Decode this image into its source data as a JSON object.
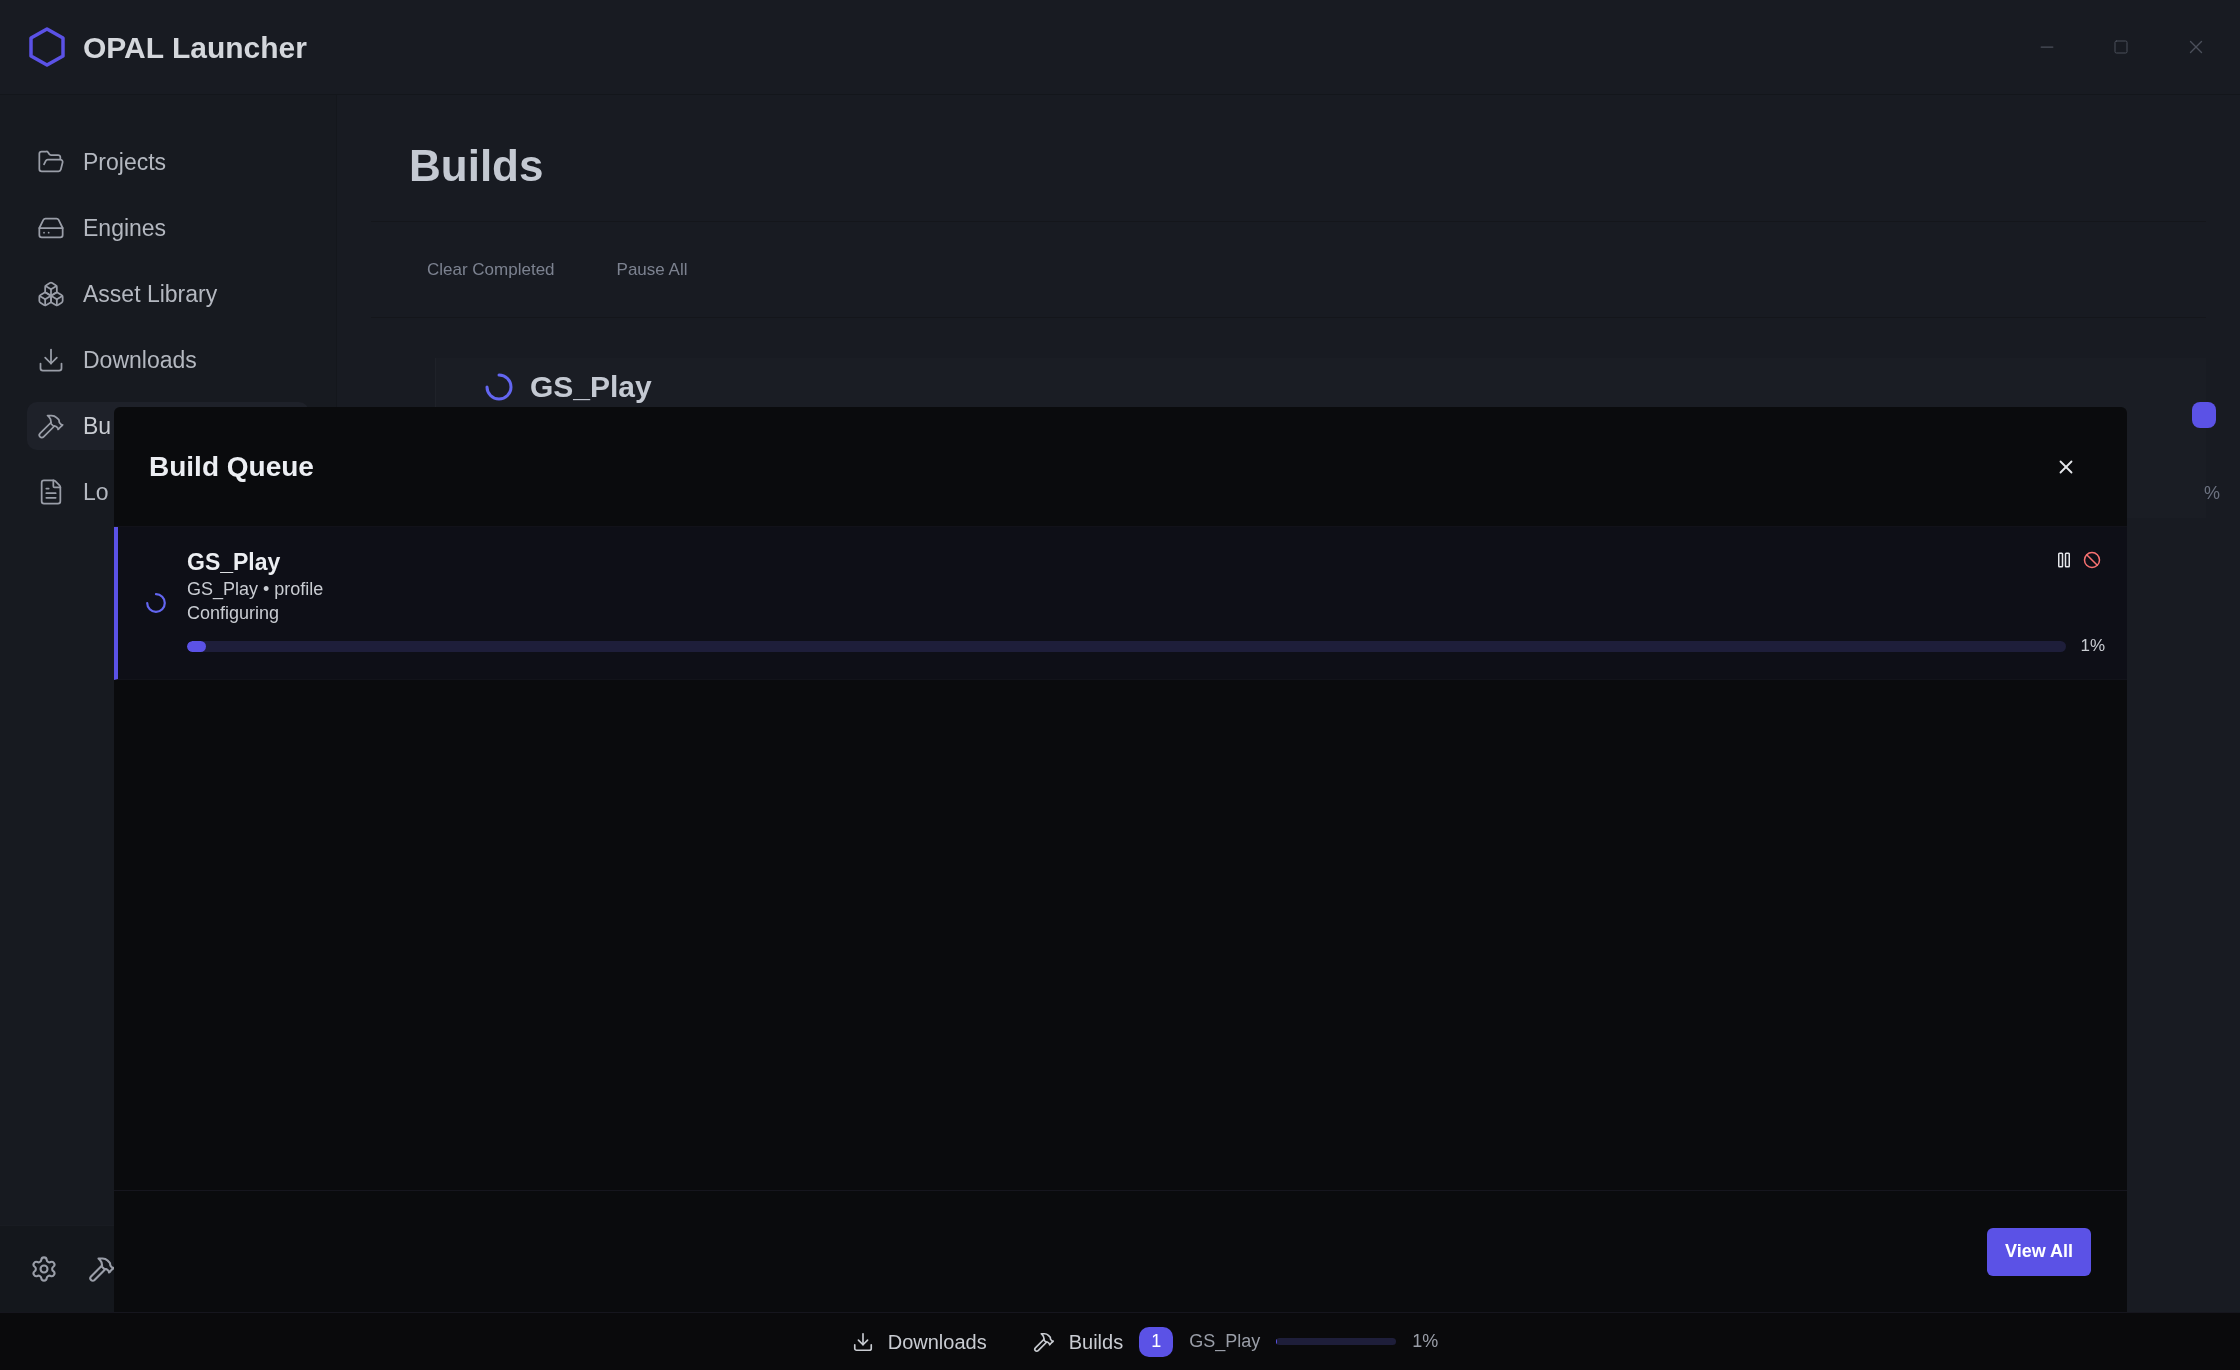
{
  "app": {
    "title": "OPAL Launcher"
  },
  "sidebar": {
    "items": [
      {
        "label": "Projects",
        "selected": false
      },
      {
        "label": "Engines",
        "selected": false
      },
      {
        "label": "Asset Library",
        "selected": false
      },
      {
        "label": "Downloads",
        "selected": false
      },
      {
        "label": "Bu",
        "selected": true
      },
      {
        "label": "Lo",
        "selected": false
      }
    ]
  },
  "page": {
    "title": "Builds",
    "actions": [
      "Clear Completed",
      "Pause All"
    ],
    "build_card": {
      "title": "GS_Play",
      "percent": "%"
    }
  },
  "modal": {
    "title": "Build Queue",
    "builds": [
      {
        "name": "GS_Play",
        "detail": "GS_Play • profile",
        "status": "Configuring",
        "level": 0.01,
        "percent": "1%"
      }
    ],
    "view_all": "View All"
  },
  "status_bar": {
    "downloads": "Downloads",
    "builds": "Builds",
    "builds_count": "1",
    "current_build": "GS_Play",
    "level": 0.01,
    "percent": "1%"
  }
}
